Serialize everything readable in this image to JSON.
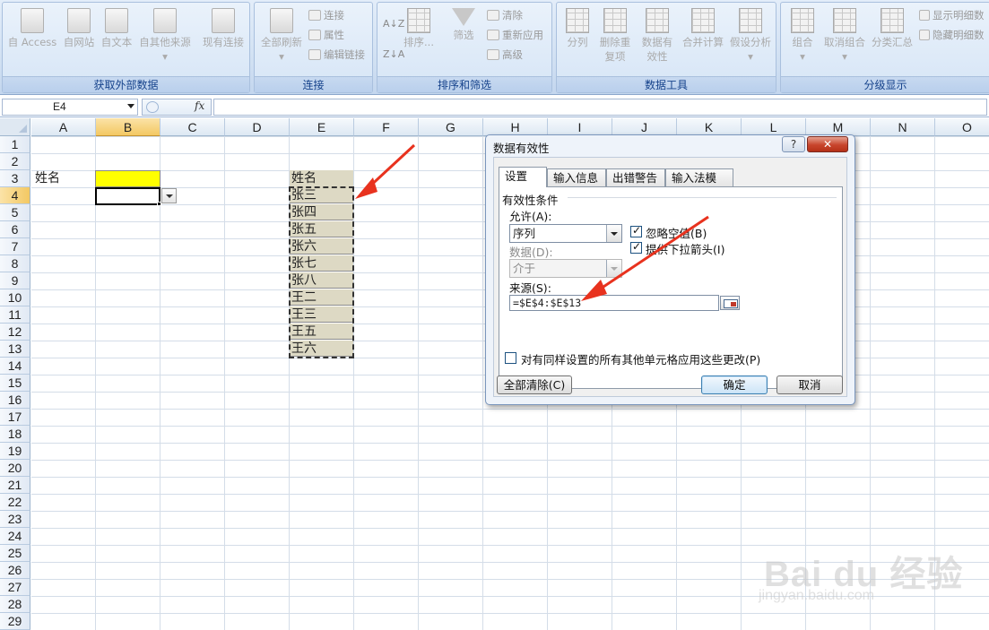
{
  "ribbon": {
    "groups": [
      {
        "label": "获取外部数据",
        "buttons": [
          "自 Access",
          "自网站",
          "自文本",
          "自其他来源",
          "现有连接"
        ]
      },
      {
        "label": "连接",
        "big": "全部刷新",
        "small": [
          "连接",
          "属性",
          "编辑链接"
        ]
      },
      {
        "label": "排序和筛选",
        "big": [
          "排序...",
          "筛选"
        ],
        "small": [
          "清除",
          "重新应用",
          "高级"
        ]
      },
      {
        "label": "数据工具",
        "buttons": [
          "分列",
          "删除重复项",
          "数据有效性",
          "合并计算",
          "假设分析"
        ]
      },
      {
        "label": "分级显示",
        "buttons": [
          "组合",
          "取消组合",
          "分类汇总"
        ],
        "small": [
          "显示明细数",
          "隐藏明细数"
        ]
      }
    ]
  },
  "formula_bar": {
    "name_box": "E4",
    "fx": "fx",
    "content": ""
  },
  "sheet": {
    "columns": [
      "A",
      "B",
      "C",
      "D",
      "E",
      "F",
      "G",
      "H",
      "I",
      "J",
      "K",
      "L",
      "M",
      "N",
      "O"
    ],
    "selected_column": "B",
    "selected_row": 4,
    "rows": 29,
    "cells": {
      "A3": "姓名",
      "E3": "姓名"
    },
    "list_values": [
      "张三",
      "张四",
      "张五",
      "张六",
      "张七",
      "张八",
      "王二",
      "王三",
      "王五",
      "王六"
    ],
    "colors": {
      "highlight_yellow": "#ffff00",
      "list_fill": "#ddd9c4",
      "arrow_red": "#e8321e"
    }
  },
  "dialog": {
    "title": "数据有效性",
    "help": "?",
    "close": "✕",
    "tabs": [
      "设置",
      "输入信息",
      "出错警告",
      "输入法模式"
    ],
    "section_title": "有效性条件",
    "allow_label": "允许(A):",
    "allow_value": "序列",
    "ignore_blank": "忽略空值(B)",
    "dropdown_arrow": "提供下拉箭头(I)",
    "data_label": "数据(D):",
    "data_value": "介于",
    "source_label": "来源(S):",
    "source_value": "=$E$4:$E$13",
    "apply_all": "对有同样设置的所有其他单元格应用这些更改(P)",
    "clear_all": "全部清除(C)",
    "ok": "确定",
    "cancel": "取消"
  },
  "watermark": {
    "text": "Bai du 经验",
    "url": "jingyan.baidu.com"
  }
}
